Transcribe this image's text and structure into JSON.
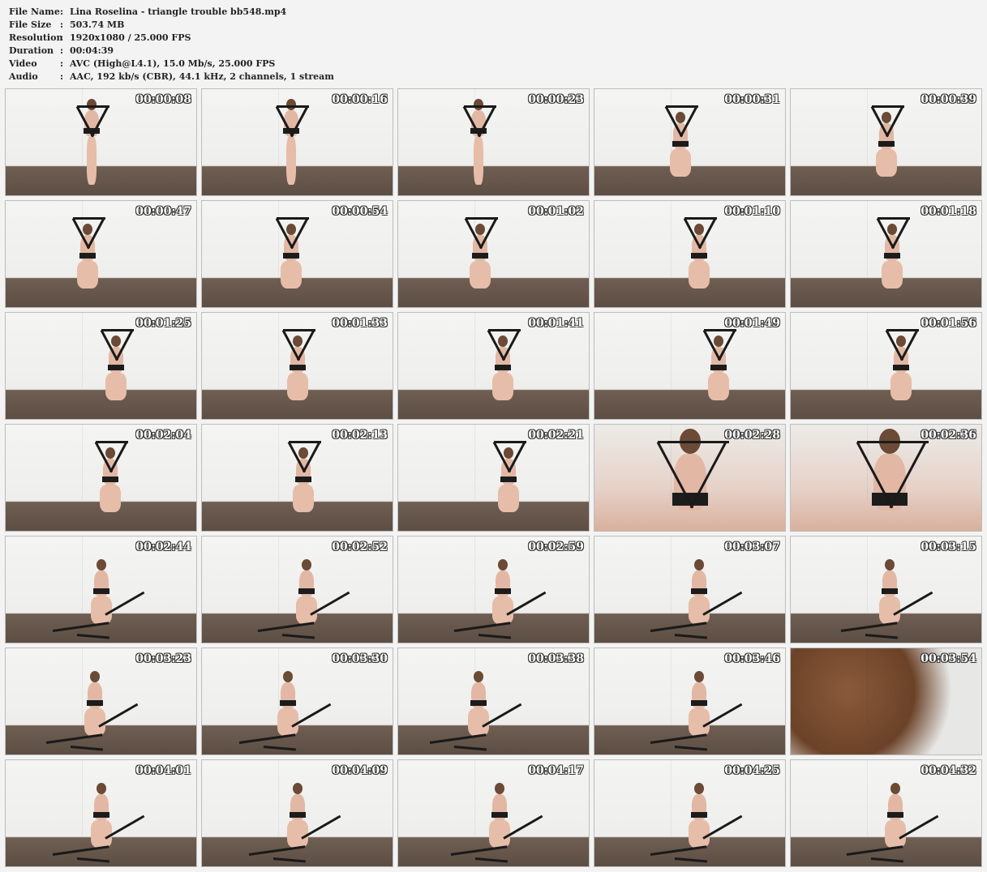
{
  "info": {
    "rows": [
      {
        "key": "File Name",
        "value": "Lina Roselina - triangle trouble bb548.mp4"
      },
      {
        "key": "File Size",
        "value": "503.74 MB"
      },
      {
        "key": "Resolution",
        "value": "1920x1080 / 25.000 FPS"
      },
      {
        "key": "Duration",
        "value": "00:04:39"
      },
      {
        "key": "Video",
        "value": "AVC (High@L4.1), 15.0 Mb/s, 25.000 FPS"
      },
      {
        "key": "Audio",
        "value": "AAC, 192 kb/s (CBR), 44.1 kHz, 2 channels, 1 stream"
      }
    ]
  },
  "thumbnails": [
    {
      "time": "00:00:08"
    },
    {
      "time": "00:00:16"
    },
    {
      "time": "00:00:23"
    },
    {
      "time": "00:00:31"
    },
    {
      "time": "00:00:39"
    },
    {
      "time": "00:00:47"
    },
    {
      "time": "00:00:54"
    },
    {
      "time": "00:01:02"
    },
    {
      "time": "00:01:10"
    },
    {
      "time": "00:01:18"
    },
    {
      "time": "00:01:25"
    },
    {
      "time": "00:01:33"
    },
    {
      "time": "00:01:41"
    },
    {
      "time": "00:01:49"
    },
    {
      "time": "00:01:56"
    },
    {
      "time": "00:02:04"
    },
    {
      "time": "00:02:13"
    },
    {
      "time": "00:02:21"
    },
    {
      "time": "00:02:28"
    },
    {
      "time": "00:02:36"
    },
    {
      "time": "00:02:44"
    },
    {
      "time": "00:02:52"
    },
    {
      "time": "00:02:59"
    },
    {
      "time": "00:03:07"
    },
    {
      "time": "00:03:15"
    },
    {
      "time": "00:03:23"
    },
    {
      "time": "00:03:30"
    },
    {
      "time": "00:03:38"
    },
    {
      "time": "00:03:46"
    },
    {
      "time": "00:03:54"
    },
    {
      "time": "00:04:01"
    },
    {
      "time": "00:04:09"
    },
    {
      "time": "00:04:17"
    },
    {
      "time": "00:04:25"
    },
    {
      "time": "00:04:32"
    }
  ]
}
